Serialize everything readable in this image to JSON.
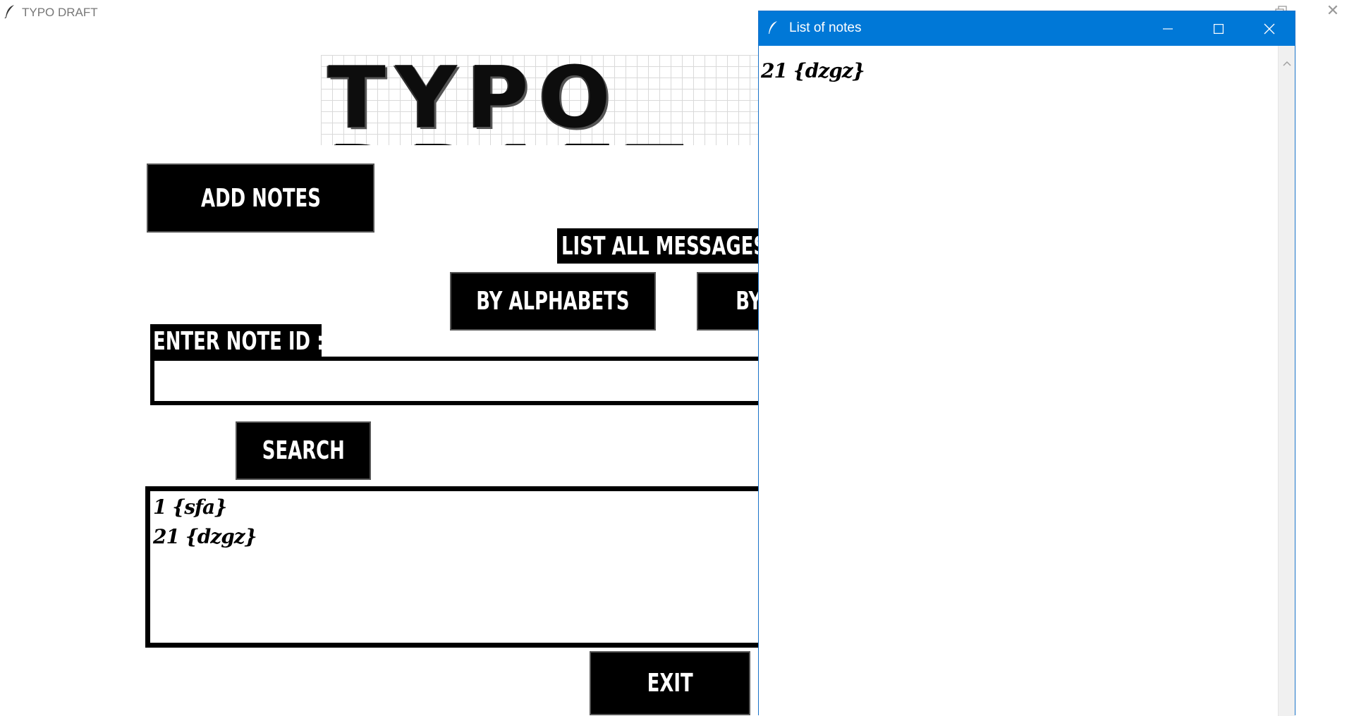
{
  "main_window": {
    "title": "TYPO DRAFT",
    "logo_text": "TYPO DRAFT",
    "add_notes_label": "ADD NOTES",
    "list_all_label": "LIST ALL MESSAGES :",
    "by_alphabets_label": "BY ALPHABETS",
    "by_id_label": "BY",
    "enter_note_id_label": "ENTER NOTE ID :",
    "note_id_value": "",
    "search_label": "SEARCH",
    "output_lines": [
      "1 {sfa}",
      "21 {dzgz}"
    ],
    "exit_label": "EXIT",
    "icons": [
      "quill-icon",
      "restore-icon",
      "close-icon"
    ]
  },
  "notes_window": {
    "title": "List of notes",
    "items": [
      "21 {dzgz}"
    ],
    "controls": [
      "minimize-icon",
      "maximize-icon",
      "close-icon"
    ],
    "titlebar_color": "#0078d7"
  }
}
